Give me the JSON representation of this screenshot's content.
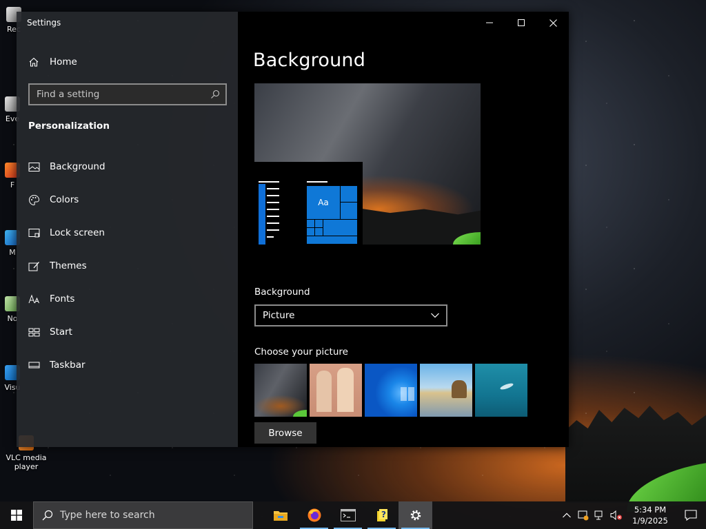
{
  "desktop": {
    "icons": [
      {
        "label": "Rec"
      },
      {
        "label": "Eve"
      },
      {
        "label": "F"
      },
      {
        "label": "M"
      },
      {
        "label": "No"
      },
      {
        "label": "Visu"
      },
      {
        "label": "VLC media player"
      }
    ]
  },
  "window": {
    "title": "Settings",
    "home_label": "Home",
    "search_placeholder": "Find a setting",
    "section_title": "Personalization",
    "nav_items": [
      {
        "label": "Background",
        "icon": "image-icon"
      },
      {
        "label": "Colors",
        "icon": "palette-icon"
      },
      {
        "label": "Lock screen",
        "icon": "lock-screen-icon"
      },
      {
        "label": "Themes",
        "icon": "themes-icon"
      },
      {
        "label": "Fonts",
        "icon": "fonts-icon"
      },
      {
        "label": "Start",
        "icon": "start-icon"
      },
      {
        "label": "Taskbar",
        "icon": "taskbar-icon"
      }
    ],
    "controls": [
      "minimize",
      "maximize",
      "close"
    ]
  },
  "content": {
    "page_title": "Background",
    "preview_tile_text": "Aa",
    "background_label": "Background",
    "background_value": "Picture",
    "choose_label": "Choose your picture",
    "thumbnails": [
      "milky-way",
      "people",
      "windows-blue",
      "beach-rocks",
      "underwater"
    ],
    "browse_label": "Browse"
  },
  "taskbar": {
    "search_placeholder": "Type here to search",
    "apps": [
      "file-explorer",
      "firefox",
      "terminal",
      "help",
      "settings"
    ],
    "time": "5:34 PM",
    "date": "1/9/2025"
  },
  "colors": {
    "accent": "#0f78d7",
    "sidebar_bg": "#26282c",
    "content_bg": "#000000"
  }
}
